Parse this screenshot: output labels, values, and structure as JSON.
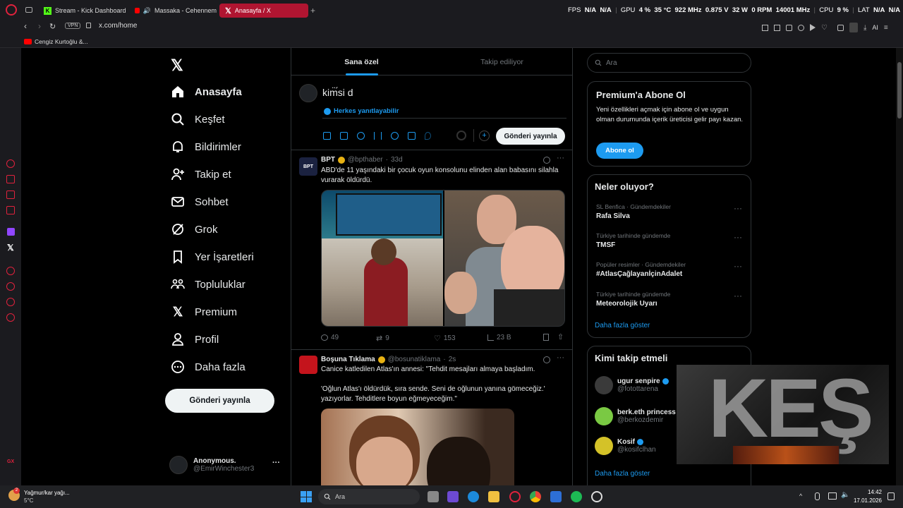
{
  "browser": {
    "tabs": [
      {
        "label": "Stream - Kick Dashboard"
      },
      {
        "label": "Massaka - Cehennem"
      },
      {
        "label": "Anasayfa / X"
      }
    ],
    "url": "x.com/home",
    "vpn": "VPN",
    "bookmark": "Cengiz Kurtoğlu &...",
    "stats": {
      "fps_label": "FPS",
      "fps1": "N/A",
      "fps2": "N/A",
      "gpu_label": "GPU",
      "gpu_pct": "4 %",
      "gpu_temp": "35 °C",
      "gpu_clock": "922 MHz",
      "gpu_volt": "0.875 V",
      "gpu_power": "32 W",
      "gpu_rpm": "0 RPM",
      "gpu_mem": "14001 MHz",
      "cpu_label": "CPU",
      "cpu_pct": "9 %",
      "lat_label": "LAT",
      "lat1": "N/A",
      "lat2": "N/A"
    },
    "ai_label": "AI"
  },
  "nav": {
    "items": [
      "Anasayfa",
      "Keşfet",
      "Bildirimler",
      "Takip et",
      "Sohbet",
      "Grok",
      "Yer İşaretleri",
      "Topluluklar",
      "Premium",
      "Profil",
      "Daha fazla"
    ],
    "post_button": "Gönderi yayınla",
    "account": {
      "name": "Anonymous.",
      "handle": "@EmirWinchester3",
      "more": "···"
    }
  },
  "feed": {
    "tabs": [
      "Sana özel",
      "Takip ediliyor"
    ],
    "composer": {
      "text": "kim̈́si d",
      "reply_setting": "Herkes yanıtlayabilir",
      "post_button": "Gönderi yayınla"
    },
    "tweets": [
      {
        "name": "BPT",
        "handle": "@bpthaber",
        "time": "33d",
        "avatar_text": "BPT",
        "text": "ABD'de 11 yaşındaki bir çocuk oyun konsolunu elinden alan babasını silahla vurarak öldürdü.",
        "replies": "49",
        "retweets": "9",
        "likes": "153",
        "views": "23 B"
      },
      {
        "name": "Boşuna Tıklama",
        "handle": "@bosunatiklama",
        "time": "2s",
        "text1": "Canice katledilen Atlas'ın annesi: \"Tehdit mesajları almaya başladım.",
        "text2": "'Oğlun Atlas'ı öldürdük, sıra sende. Seni de oğlunun yanına gömeceğiz.' yazıyorlar. Tehditlere boyun eğmeyeceğim.\""
      }
    ]
  },
  "right": {
    "search_placeholder": "Ara",
    "premium": {
      "title": "Premium'a Abone Ol",
      "text": "Yeni özellikleri açmak için abone ol ve uygun olman durumunda içerik üreticisi gelir payı kazan.",
      "button": "Abone ol"
    },
    "trends": {
      "title": "Neler oluyor?",
      "items": [
        {
          "context": "SL Benfica · Gündemdekiler",
          "topic": "Rafa Silva"
        },
        {
          "context": "Türkiye tarihinde gündemde",
          "topic": "TMSF"
        },
        {
          "context": "Popüler resimler · Gündemdekiler",
          "topic": "#AtlasÇağlayanİçinAdalet"
        },
        {
          "context": "Türkiye tarihinde gündemde",
          "topic": "Meteorolojik Uyarı"
        }
      ],
      "show_more": "Daha fazla göster"
    },
    "follow": {
      "title": "Kimi takip etmeli",
      "items": [
        {
          "name": "ugur senpire",
          "handle": "@fotottarena"
        },
        {
          "name": "berk.eth princess",
          "handle": "@berkozdemir"
        },
        {
          "name": "Kosif",
          "handle": "@kosifclhan"
        }
      ],
      "show_more": "Daha fazla göster"
    },
    "overlay_text": "KEŞ"
  },
  "taskbar": {
    "weather": "Yağmur/kar yağı...",
    "temp": "5°C",
    "weather_badge": "2",
    "search": "Ara",
    "time": "14:42",
    "date": "17.01.2026"
  },
  "colors": {
    "accent": "#1d9bf0",
    "opera_red": "#e0223d",
    "tab_active": "#b01531",
    "verified": "#e8b213"
  }
}
